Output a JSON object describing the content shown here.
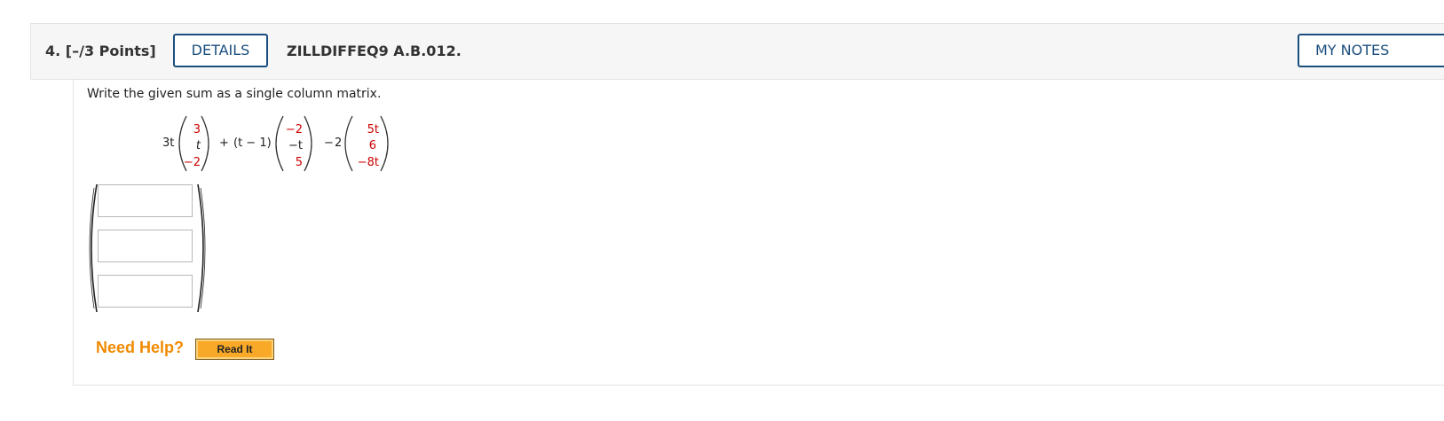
{
  "question": {
    "number_points": "4.  [–/3 Points]",
    "details_label": "DETAILS",
    "id": "ZILLDIFFEQ9 A.B.012.",
    "my_notes_label": "MY NOTES",
    "prompt": "Write the given sum as a single column matrix."
  },
  "expression": {
    "term1_coef": "3t",
    "vec1": [
      "3",
      "t",
      "−2"
    ],
    "plus": "+",
    "term2_coef": "(t − 1)",
    "vec2": [
      "−2",
      "−t",
      "5"
    ],
    "minus": "−",
    "term3_coef": "2",
    "vec3": [
      "5t",
      "6",
      "−8t"
    ]
  },
  "answer": {
    "inputs": [
      {
        "value": "",
        "placeholder": ""
      },
      {
        "value": "",
        "placeholder": ""
      },
      {
        "value": "",
        "placeholder": ""
      }
    ]
  },
  "help": {
    "label": "Need Help?",
    "read_it_label": "Read It"
  },
  "colors": {
    "link_blue": "#1a4e7d",
    "highlight_red": "#cc0000",
    "help_orange": "#f08a00",
    "button_orange": "#f8a928"
  }
}
